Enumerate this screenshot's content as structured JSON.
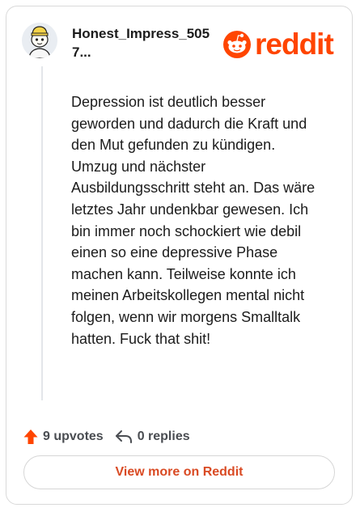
{
  "post": {
    "username": "Honest_Impress_5057...",
    "body": "Depression ist deutlich besser geworden und dadurch die Kraft und den Mut gefunden zu kündigen. Umzug und nächster Ausbildungsschritt steht an. Das wäre letztes Jahr undenkbar gewesen. Ich bin immer noch schockiert wie debil einen so eine depressive Phase machen kann. Teilweise konnte ich meinen Arbeitskollegen mental nicht folgen, wenn wir morgens Smalltalk hatten. Fuck that shit!"
  },
  "brand": {
    "wordmark": "reddit",
    "color": "#ff4500"
  },
  "stats": {
    "upvotes": "9 upvotes",
    "replies": "0 replies"
  },
  "view_more_label": "View more on Reddit",
  "icons": {
    "avatar": "snoo-avatar",
    "logo": "reddit-snoo-icon",
    "upvote": "upvote-arrow-icon",
    "reply": "reply-arrow-icon"
  }
}
